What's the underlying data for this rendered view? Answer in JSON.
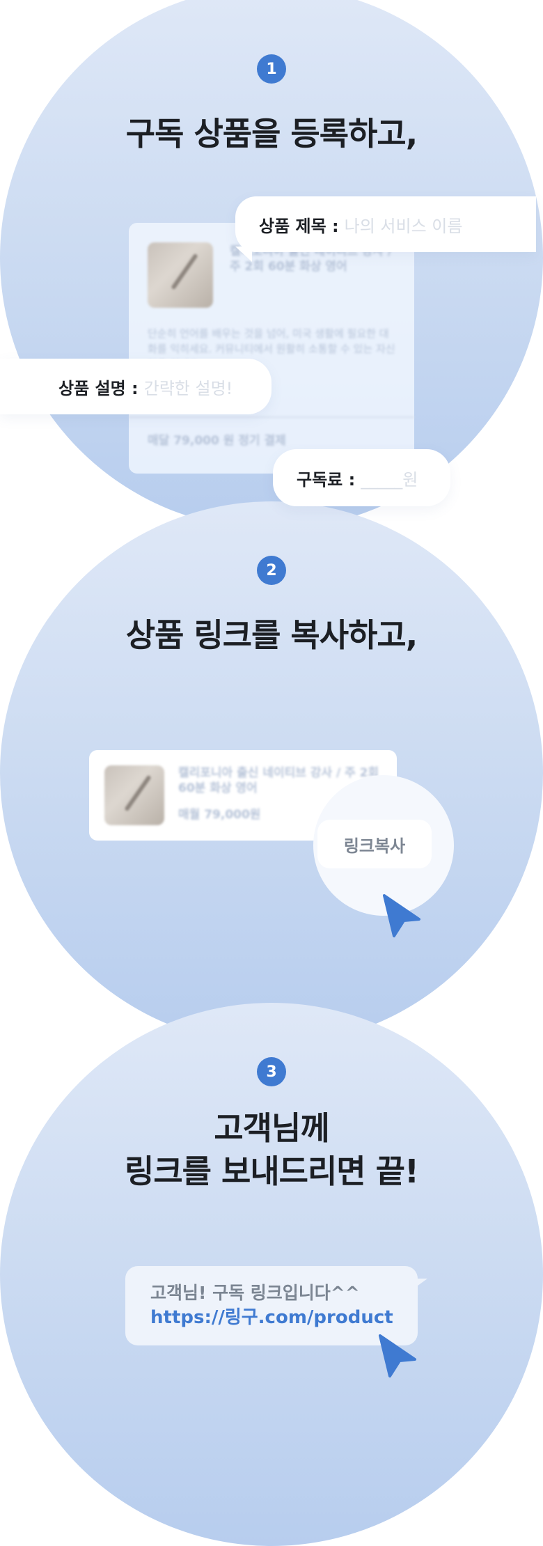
{
  "step1": {
    "number": "1",
    "title": "구독 상품을 등록하고,",
    "title_pill": {
      "label": "상품 제목 :",
      "placeholder": "나의 서비스 이름"
    },
    "desc_pill": {
      "label": "상품 설명 :",
      "placeholder": "간략한 설명!"
    },
    "price_pill": {
      "label": "구독료 :",
      "placeholder": "_____원"
    },
    "card": {
      "title": "캘리포니아 출신 네이티브 강사 / 주 2회 60분 화상 영어",
      "desc": "단순히 언어를 배우는 것을 넘어, 미국 생활에 필요한 대화를 익히세요. 커뮤니티에서 원활히 소통할 수 있는 자신감을 전세요",
      "price": "매달 79,000 원 정기 결제"
    }
  },
  "step2": {
    "number": "2",
    "title": "상품 링크를 복사하고,",
    "card": {
      "title": "캘리포니아 출신 네이티브 강사 / 주 2회 60분 화상 영어",
      "price": "매월 79,000원"
    },
    "copy_label": "링크복사"
  },
  "step3": {
    "number": "3",
    "title_line1": "고객님께",
    "title_line2": "링크를 보내드리면 끝!",
    "message": "고객님! 구독 링크입니다^^",
    "link": "https://링구.com/product"
  },
  "colors": {
    "accent": "#3f7ad1",
    "circle_top": "#dfe8f7",
    "circle_bottom": "#b7cdee",
    "placeholder": "#d9dee6"
  },
  "icons": [
    "cursor-pointer-icon",
    "product-thumbnail"
  ]
}
